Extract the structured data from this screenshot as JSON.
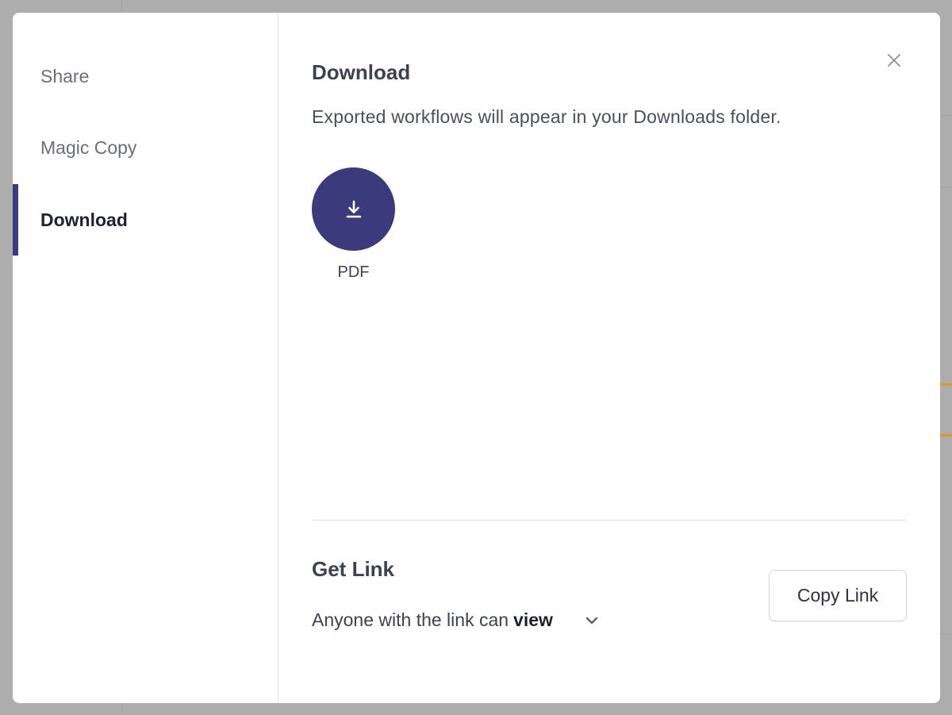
{
  "sidebar": {
    "items": [
      {
        "label": "Share"
      },
      {
        "label": "Magic Copy"
      },
      {
        "label": "Download",
        "active": true
      }
    ]
  },
  "download": {
    "title": "Download",
    "description": "Exported workflows will appear in your Downloads folder.",
    "option": {
      "label": "PDF",
      "icon": "download-icon"
    }
  },
  "get_link": {
    "title": "Get Link",
    "permission_prefix": "Anyone with the link can",
    "permission_value": "view",
    "copy_label": "Copy Link"
  },
  "colors": {
    "accent": "#3b3a7d",
    "overlay": "#adadad",
    "highlight": "#d99a2b"
  }
}
